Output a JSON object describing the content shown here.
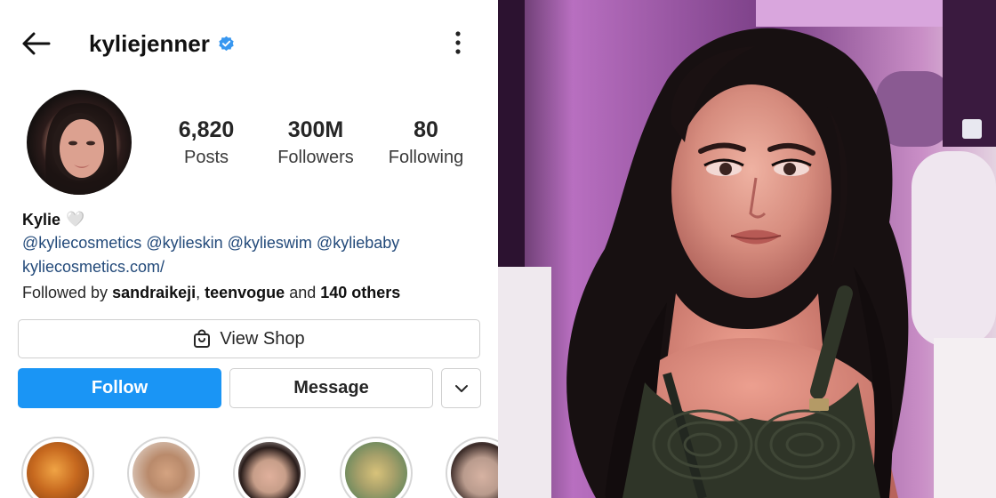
{
  "header": {
    "username": "kyliejenner",
    "back_icon": "arrow-left-icon",
    "verified_icon": "verified-badge-icon",
    "more_icon": "more-vertical-icon",
    "verified_color": "#3897f0"
  },
  "stats": [
    {
      "value": "6,820",
      "label": "Posts"
    },
    {
      "value": "300M",
      "label": "Followers"
    },
    {
      "value": "80",
      "label": "Following"
    }
  ],
  "bio": {
    "name": "Kylie",
    "heart": "🤍",
    "mentions": [
      "@kyliecosmetics",
      "@kylieskin",
      "@kylieswim",
      "@kyliebaby"
    ],
    "website": "kyliecosmetics.com/",
    "followed_by_prefix": "Followed by",
    "followed_by_users": [
      "sandraikeji",
      "teenvogue"
    ],
    "followed_by_and": "and",
    "followed_by_others": "140 others"
  },
  "actions": {
    "shop_icon": "shopping-bag-icon",
    "shop_label": "View Shop",
    "follow_label": "Follow",
    "message_label": "Message",
    "suggest_icon": "chevron-down-icon",
    "follow_color": "#1a95f5"
  },
  "highlights": [
    {
      "icon": "story-highlight-1",
      "color": "#c7691f"
    },
    {
      "icon": "story-highlight-2",
      "color": "#b98a6b"
    },
    {
      "icon": "story-highlight-3",
      "color": "#c79e89"
    },
    {
      "icon": "story-highlight-4",
      "color": "#a7a06a"
    },
    {
      "icon": "story-highlight-5",
      "color": "#b99b8d"
    }
  ]
}
